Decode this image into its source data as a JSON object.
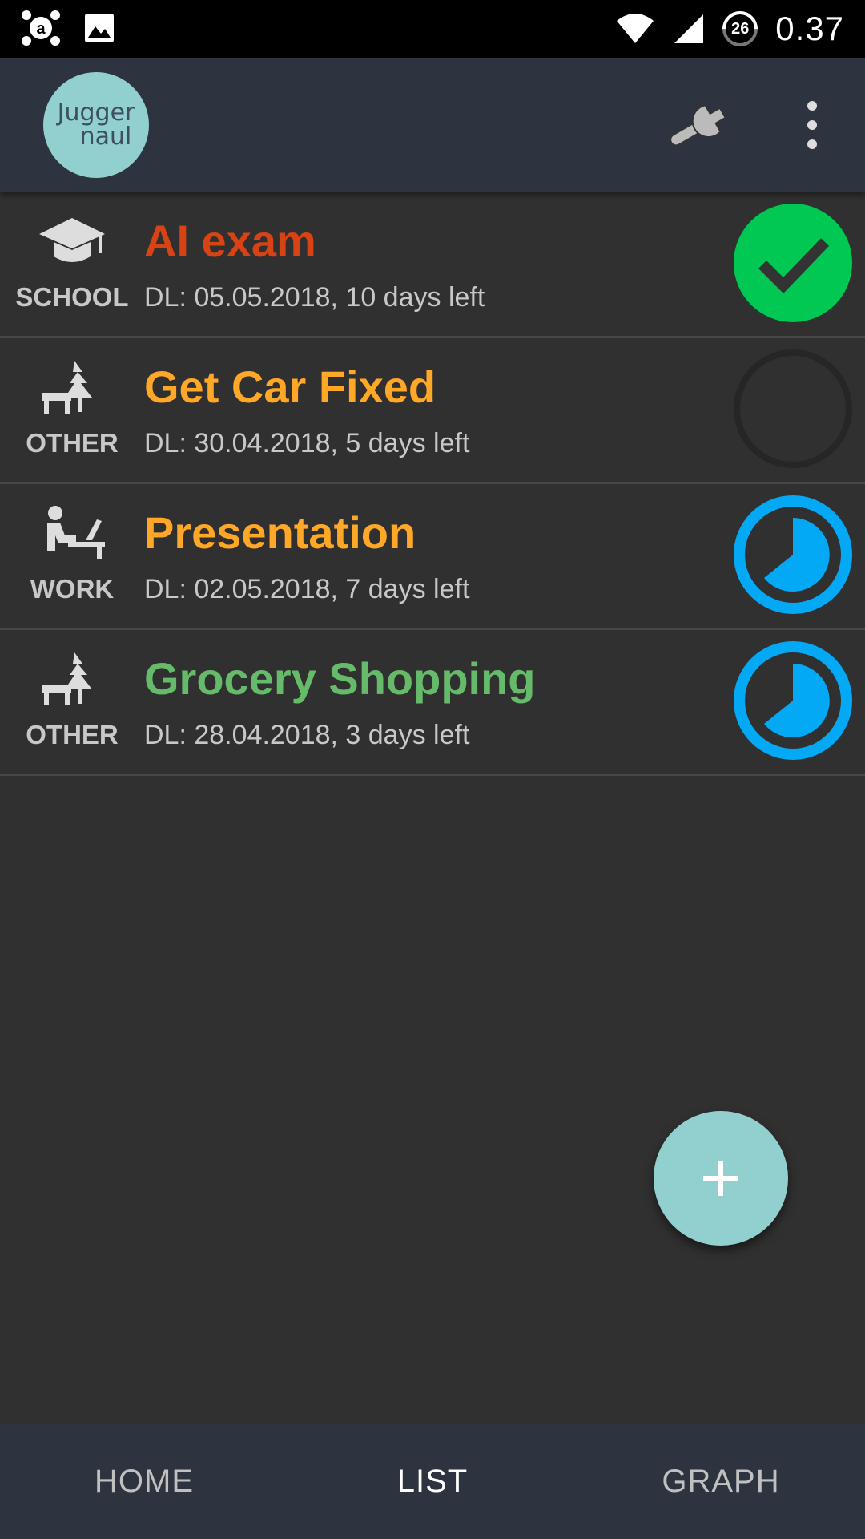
{
  "status_bar": {
    "time": "0.37",
    "battery": "26"
  },
  "app_bar": {
    "logo_line1": "Jugger",
    "logo_line2": "naul"
  },
  "tasks": [
    {
      "category": "SCHOOL",
      "title": "AI exam",
      "deadline": "DL: 05.05.2018, 10 days left",
      "title_color": "#d84315",
      "status": "done"
    },
    {
      "category": "OTHER",
      "title": "Get Car Fixed",
      "deadline": "DL: 30.04.2018, 5 days left",
      "title_color": "#ffa726",
      "status": "not-started"
    },
    {
      "category": "WORK",
      "title": "Presentation",
      "deadline": "DL: 02.05.2018, 7 days left",
      "title_color": "#ffa726",
      "status": "in-progress"
    },
    {
      "category": "OTHER",
      "title": "Grocery Shopping",
      "deadline": "DL: 28.04.2018, 3 days left",
      "title_color": "#66bb6a",
      "status": "in-progress"
    }
  ],
  "bottom_nav": {
    "home": "HOME",
    "list": "LIST",
    "graph": "GRAPH",
    "active": "LIST"
  },
  "colors": {
    "accent": "#92d0d0",
    "done": "#00c853",
    "progress": "#03a9f4",
    "app_bar": "#2e3340"
  }
}
